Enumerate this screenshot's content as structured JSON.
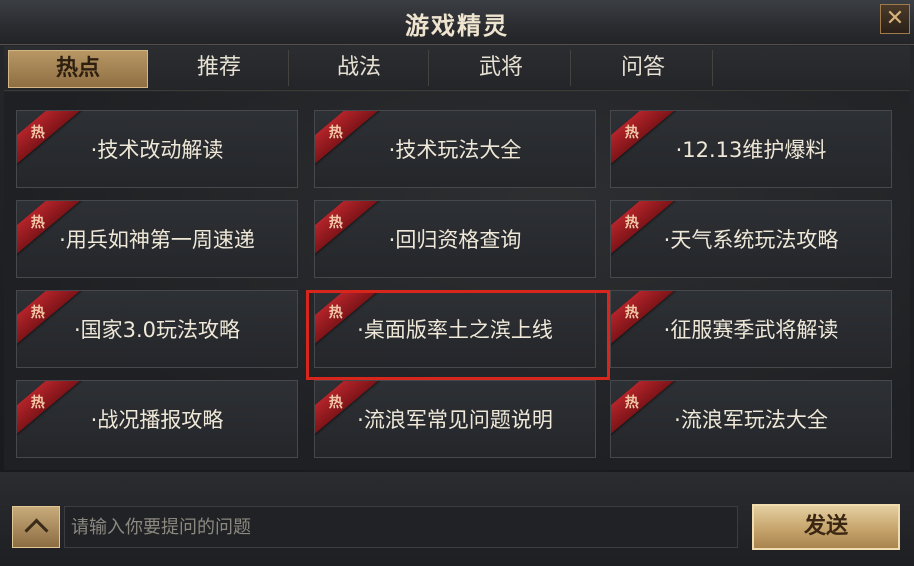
{
  "window": {
    "title": "游戏精灵",
    "close_symbol": "✕"
  },
  "tabs": [
    {
      "label": "热点",
      "active": true
    },
    {
      "label": "推荐",
      "active": false
    },
    {
      "label": "战法",
      "active": false
    },
    {
      "label": "武将",
      "active": false
    },
    {
      "label": "问答",
      "active": false
    }
  ],
  "hot_tag": "热",
  "items": [
    "·技术改动解读",
    "·技术玩法大全",
    "·12.13维护爆料",
    "·用兵如神第一周速递",
    "·回归资格查询",
    "·天气系统玩法攻略",
    "·国家3.0玩法攻略",
    "·桌面版率土之滨上线",
    "·征服赛季武将解读",
    "·战况播报攻略",
    "·流浪军常见问题说明",
    "·流浪军玩法大全"
  ],
  "input": {
    "placeholder": "请输入你要提问的问题",
    "value": ""
  },
  "send_label": "发送",
  "colors": {
    "accent_gold": "#c6a46c",
    "hot_red": "#b3242a",
    "highlight_red": "#d9261c"
  }
}
